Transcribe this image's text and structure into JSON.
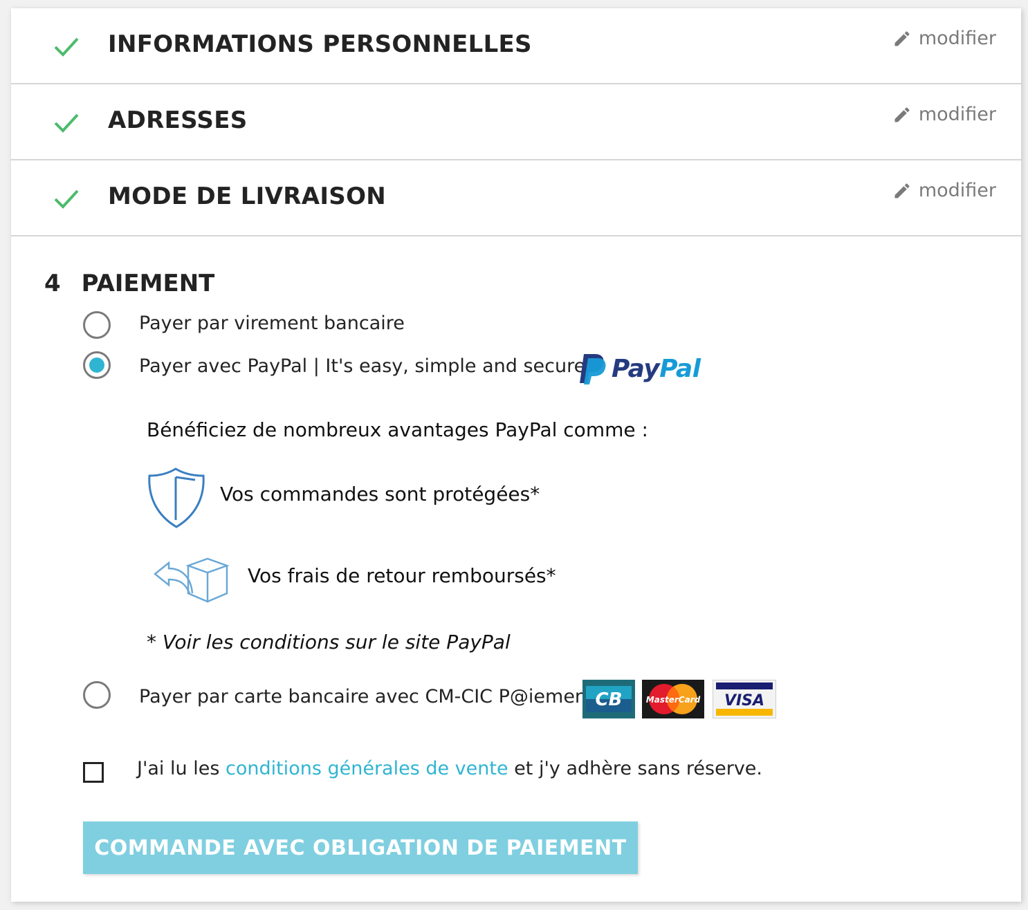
{
  "steps": [
    {
      "title": "INFORMATIONS PERSONNELLES",
      "edit_label": "modifier",
      "status": "completed"
    },
    {
      "title": "ADRESSES",
      "edit_label": "modifier",
      "status": "completed"
    },
    {
      "title": "MODE DE LIVRAISON",
      "edit_label": "modifier",
      "status": "completed"
    }
  ],
  "payment": {
    "step_number": "4",
    "title": "PAIEMENT",
    "options": [
      {
        "label": "Payer par virement bancaire",
        "selected": false
      },
      {
        "label": "Payer avec PayPal | It's easy, simple and secure",
        "selected": true
      },
      {
        "label": "Payer par carte bancaire avec CM-CIC P@iement",
        "selected": false
      }
    ],
    "paypal_logo": {
      "pay": "Pay",
      "pal": "Pal"
    },
    "paypal_benefits_intro": "Bénéficiez de nombreux avantages PayPal comme :",
    "paypal_benefits": [
      {
        "text": "Vos commandes sont protégées*",
        "icon": "shield-icon"
      },
      {
        "text": "Vos frais de retour remboursés*",
        "icon": "return-box-icon"
      }
    ],
    "paypal_note": "* Voir les conditions sur le site PayPal",
    "card_logos": [
      "CB",
      "MasterCard",
      "VISA"
    ],
    "terms": {
      "before": "J'ai lu les ",
      "link": "conditions générales de vente",
      "after": " et j'y adhère sans réserve.",
      "checked": false
    },
    "submit_label": "COMMANDE AVEC OBLIGATION DE PAIEMENT"
  },
  "colors": {
    "check": "#4cbb6c",
    "accent": "#2fb5d2",
    "button_disabled": "#7fcfe0",
    "paypal_dark": "#253b80",
    "paypal_light": "#179bd7"
  }
}
